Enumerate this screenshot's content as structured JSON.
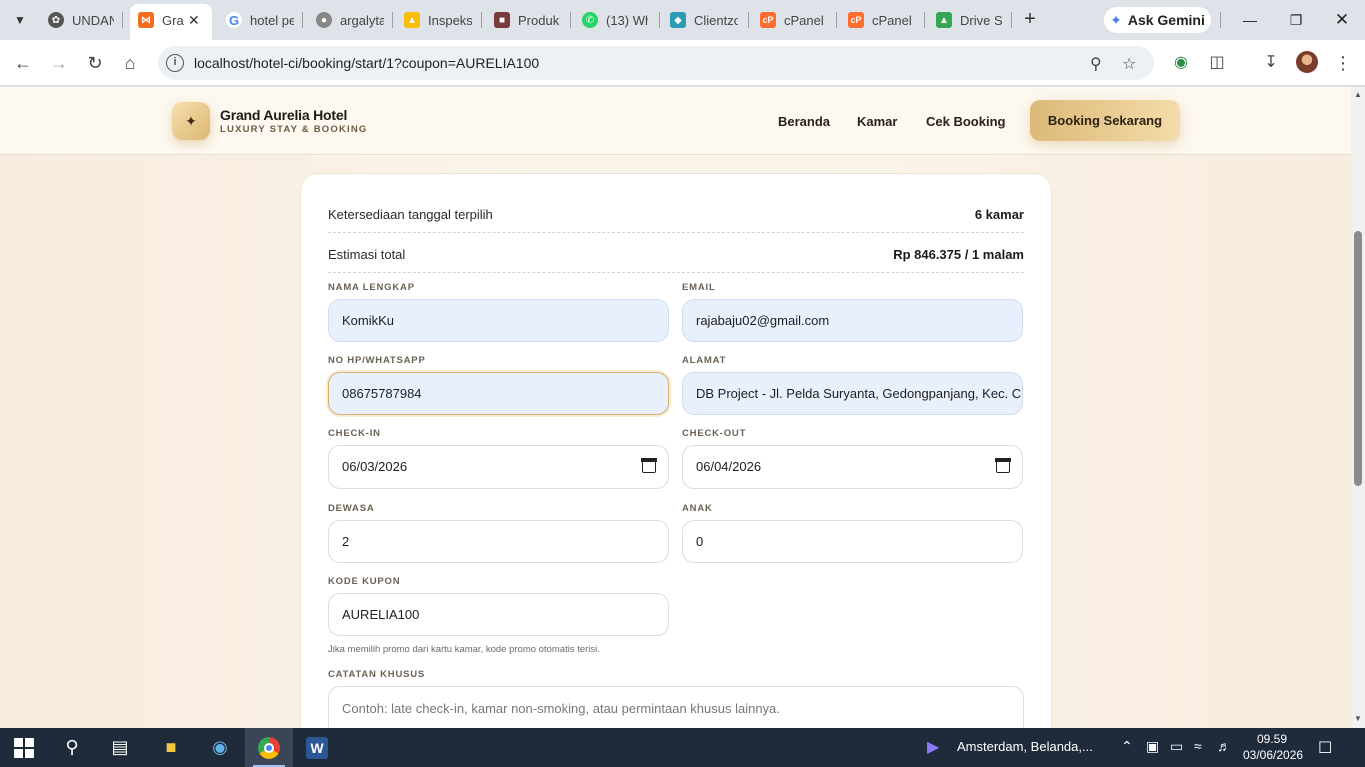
{
  "browser": {
    "tabs": [
      {
        "label": "UNDAN",
        "favicon": "chatgpt-icon",
        "color": "#555555"
      },
      {
        "label": "Gra",
        "favicon": "xampp-icon",
        "color": "#f26d21",
        "active": true
      },
      {
        "label": "hotel pe",
        "favicon": "google-icon",
        "color": "#4285f4"
      },
      {
        "label": "argalyta",
        "favicon": "globe-icon",
        "color": "#777777"
      },
      {
        "label": "Inspeksi",
        "favicon": "google-ads-icon",
        "color": "#fbbc04"
      },
      {
        "label": "Produk",
        "favicon": "product-icon",
        "color": "#7a3b3b"
      },
      {
        "label": "(13) Wh",
        "favicon": "whatsapp-icon",
        "color": "#25d366"
      },
      {
        "label": "Clientzo",
        "favicon": "clientzone-icon",
        "color": "#2a9db5"
      },
      {
        "label": "cPanel",
        "favicon": "cpanel-icon",
        "color": "#ff6c2c"
      },
      {
        "label": "cPanel F",
        "favicon": "cpanel-icon",
        "color": "#ff6c2c"
      },
      {
        "label": "Drive Sa",
        "favicon": "drive-icon",
        "color": "#34a853"
      }
    ],
    "gemini_label": "Ask Gemini",
    "url": "localhost/hotel-ci/booking/start/1?coupon=AURELIA100"
  },
  "site": {
    "brand_name": "Grand Aurelia Hotel",
    "brand_tagline": "LUXURY STAY & BOOKING",
    "nav": [
      "Beranda",
      "Kamar",
      "Cek Booking"
    ],
    "cta": "Booking Sekarang"
  },
  "summary": {
    "availability_label": "Ketersediaan tanggal terpilih",
    "availability_value": "6 kamar",
    "estimate_label": "Estimasi total",
    "estimate_value": "Rp 846.375 / 1 malam"
  },
  "form": {
    "full_name": {
      "label": "NAMA LENGKAP",
      "value": "KomikKu"
    },
    "email": {
      "label": "EMAIL",
      "value": "rajabaju02@gmail.com"
    },
    "phone": {
      "label": "NO HP/WHATSAPP",
      "value": "08675787984"
    },
    "address": {
      "label": "ALAMAT",
      "value": "DB Project - Jl. Pelda Suryanta, Gedongpanjang, Kec. Citamiang"
    },
    "checkin": {
      "label": "CHECK-IN",
      "value": "06/03/2026"
    },
    "checkout": {
      "label": "CHECK-OUT",
      "value": "06/04/2026"
    },
    "adults": {
      "label": "DEWASA",
      "value": "2"
    },
    "children": {
      "label": "ANAK",
      "value": "0"
    },
    "coupon": {
      "label": "KODE KUPON",
      "value": "AURELIA100",
      "hint": "Jika memilih promo dari kartu kamar, kode promo otomatis terisi."
    },
    "notes": {
      "label": "CATATAN KHUSUS",
      "placeholder": "Contoh: late check-in, kamar non-smoking, atau permintaan khusus lainnya."
    }
  },
  "taskbar": {
    "weather_text": "Amsterdam, Belanda,...",
    "time": "09.59",
    "date": "03/06/2026"
  }
}
